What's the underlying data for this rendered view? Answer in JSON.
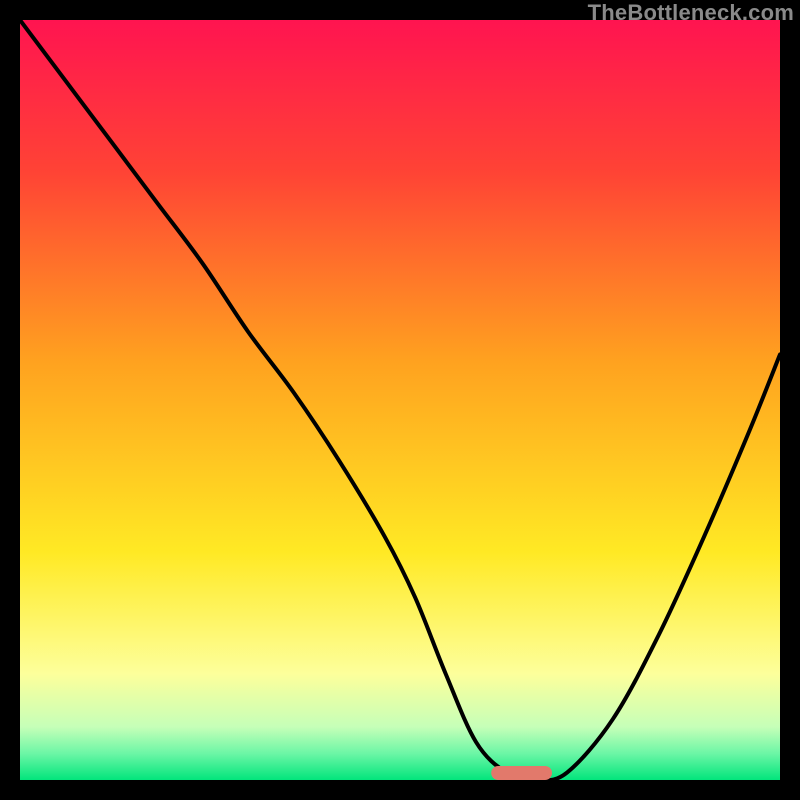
{
  "watermark": "TheBottleneck.com",
  "chart_data": {
    "type": "line",
    "title": "",
    "xlabel": "",
    "ylabel": "",
    "xlim": [
      0,
      100
    ],
    "ylim": [
      0,
      100
    ],
    "gradient_stops": [
      {
        "offset": 0,
        "color": "#ff1450"
      },
      {
        "offset": 0.2,
        "color": "#ff4335"
      },
      {
        "offset": 0.45,
        "color": "#ffa21f"
      },
      {
        "offset": 0.7,
        "color": "#ffe924"
      },
      {
        "offset": 0.86,
        "color": "#fdff9b"
      },
      {
        "offset": 0.93,
        "color": "#c6ffb8"
      },
      {
        "offset": 0.965,
        "color": "#6cf6a6"
      },
      {
        "offset": 1.0,
        "color": "#02e57c"
      }
    ],
    "series": [
      {
        "name": "bottleneck-curve",
        "x": [
          0,
          6,
          12,
          18,
          24,
          30,
          36,
          42,
          48,
          52,
          56,
          60,
          64,
          68,
          72,
          78,
          84,
          90,
          96,
          100
        ],
        "y": [
          100,
          92,
          84,
          76,
          68,
          59,
          51,
          42,
          32,
          24,
          14,
          5,
          1,
          0,
          1,
          8,
          19,
          32,
          46,
          56
        ]
      }
    ],
    "marker": {
      "x_center": 66,
      "width": 8,
      "color": "#e2796b"
    }
  }
}
